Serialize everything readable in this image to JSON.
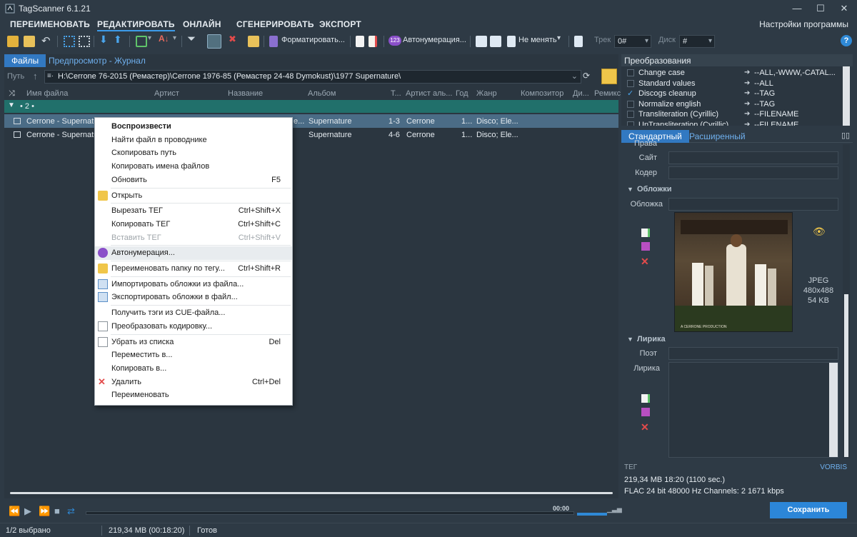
{
  "window": {
    "title": "TagScanner 6.1.21",
    "minimize": "—",
    "maximize": "☐",
    "close": "✕"
  },
  "menu": {
    "tabs": [
      "ПЕРЕИМЕНОВАТЬ",
      "РЕДАКТИРОВАТЬ",
      "ОНЛАЙН",
      "СГЕНЕРИРОВАТЬ",
      "ЭКСПОРТ"
    ],
    "active_index": 1,
    "settings": "Настройки программы"
  },
  "toolbar": {
    "format_label": "Форматировать...",
    "autonum_label": "Автонумерация...",
    "nochange_label": "Не менять",
    "track_label": "Трек",
    "track_value": "0#",
    "disc_label": "Диск",
    "disc_value": "#",
    "help": "?"
  },
  "left": {
    "tabs": [
      "Файлы",
      "Предпросмотр - Журнал"
    ],
    "path_label": "Путь",
    "path_value": "H:\\Cerrone 76-2015 (Ремастер)\\Cerrone 1976-85 (Ремастер 24-48 Dymokust)\\1977 Supernature\\",
    "columns": [
      "Имя файла",
      "Артист",
      "Название",
      "Альбом",
      "Т...",
      "Артист аль...",
      "Год",
      "Жанр",
      "Композитор",
      "Ди...",
      "Ремикс"
    ],
    "group_label": "• 2 •",
    "rows": [
      {
        "name": "Cerrone - Supernatu",
        "title_tail": "e...",
        "album": "Supernature",
        "track": "1-3",
        "album_artist": "Cerrone",
        "year": "1...",
        "genre": "Disco; Ele..."
      },
      {
        "name": "Cerrone - Supernatu",
        "title_tail": "",
        "album": "Supernature",
        "track": "4-6",
        "album_artist": "Cerrone",
        "year": "1...",
        "genre": "Disco; Ele..."
      }
    ]
  },
  "context_menu": [
    {
      "label": "Воспроизвести",
      "bold": true
    },
    {
      "label": "Найти файл в проводнике"
    },
    {
      "label": "Скопировать путь"
    },
    {
      "label": "Копировать имена файлов"
    },
    {
      "label": "Обновить",
      "shortcut": "F5"
    },
    {
      "label": "Открыть",
      "icon": "folder-open-icon"
    },
    {
      "label": "Вырезать ТЕГ",
      "shortcut": "Ctrl+Shift+X"
    },
    {
      "label": "Копировать ТЕГ",
      "shortcut": "Ctrl+Shift+C"
    },
    {
      "label": "Вставить ТЕГ",
      "shortcut": "Ctrl+Shift+V",
      "disabled": true
    },
    {
      "label": "Автонумерация...",
      "icon": "autonumber-icon"
    },
    {
      "label": "Переименовать папку по тегу...",
      "shortcut": "Ctrl+Shift+R",
      "icon": "folder-icon"
    },
    {
      "label": "Импортировать обложки из файла...",
      "icon": "import-cover-icon"
    },
    {
      "label": "Экспортировать обложки в файл...",
      "icon": "export-cover-icon"
    },
    {
      "label": "Получить тэги из CUE-файла..."
    },
    {
      "label": "Преобразовать кодировку...",
      "icon": "document-icon"
    },
    {
      "label": "Убрать из списка",
      "shortcut": "Del",
      "icon": "document-icon"
    },
    {
      "label": "Переместить в..."
    },
    {
      "label": "Копировать в..."
    },
    {
      "label": "Удалить",
      "shortcut": "Ctrl+Del",
      "icon": "delete-x-icon"
    },
    {
      "label": "Переименовать"
    }
  ],
  "player": {
    "time": "00:00"
  },
  "status": {
    "selected": "1/2 выбрано",
    "size": "219,34 MB (00:18:20)",
    "state": "Готов"
  },
  "right": {
    "transform_title": "Преобразования",
    "transforms": [
      {
        "name": "Change case",
        "value": "--ALL,-WWW,-CATAL...",
        "checked": false
      },
      {
        "name": "Standard values",
        "value": "--ALL",
        "checked": false
      },
      {
        "name": "Discogs cleanup",
        "value": "--TAG",
        "checked": true
      },
      {
        "name": "Normalize english",
        "value": "--TAG",
        "checked": false
      },
      {
        "name": "Transliteration (Cyrillic)",
        "value": "--FILENAME",
        "checked": false
      },
      {
        "name": "UnTransliteration (Cyrillic)",
        "value": "--FILENAME",
        "checked": false
      }
    ],
    "tabs": [
      "Стандартный",
      "Расширенный"
    ],
    "field_rights": "Права",
    "field_site": "Сайт",
    "field_encoder": "Кодер",
    "section_covers": "Обложки",
    "field_cover": "Обложка",
    "cover_format": "JPEG",
    "cover_dims": "480x488",
    "cover_size": "54 KB",
    "cover_text_line": "A CERRONE PRODUCTION",
    "section_lyrics": "Лирика",
    "field_poet": "Поэт",
    "field_lyrics": "Лирика",
    "tag_label": "ТЕГ",
    "tag_type": "VORBIS",
    "info_line1": "219,34 MB  18:20 (1100 sec.)",
    "info_line2": "FLAC  24 bit  48000 Hz  Channels: 2  1671 kbps",
    "save": "Сохранить"
  },
  "colors": {
    "accent": "#3279c2",
    "link": "#6fb0ee",
    "group": "#21706b",
    "selected_row": "#4b6c86",
    "save": "#2c86d8"
  }
}
